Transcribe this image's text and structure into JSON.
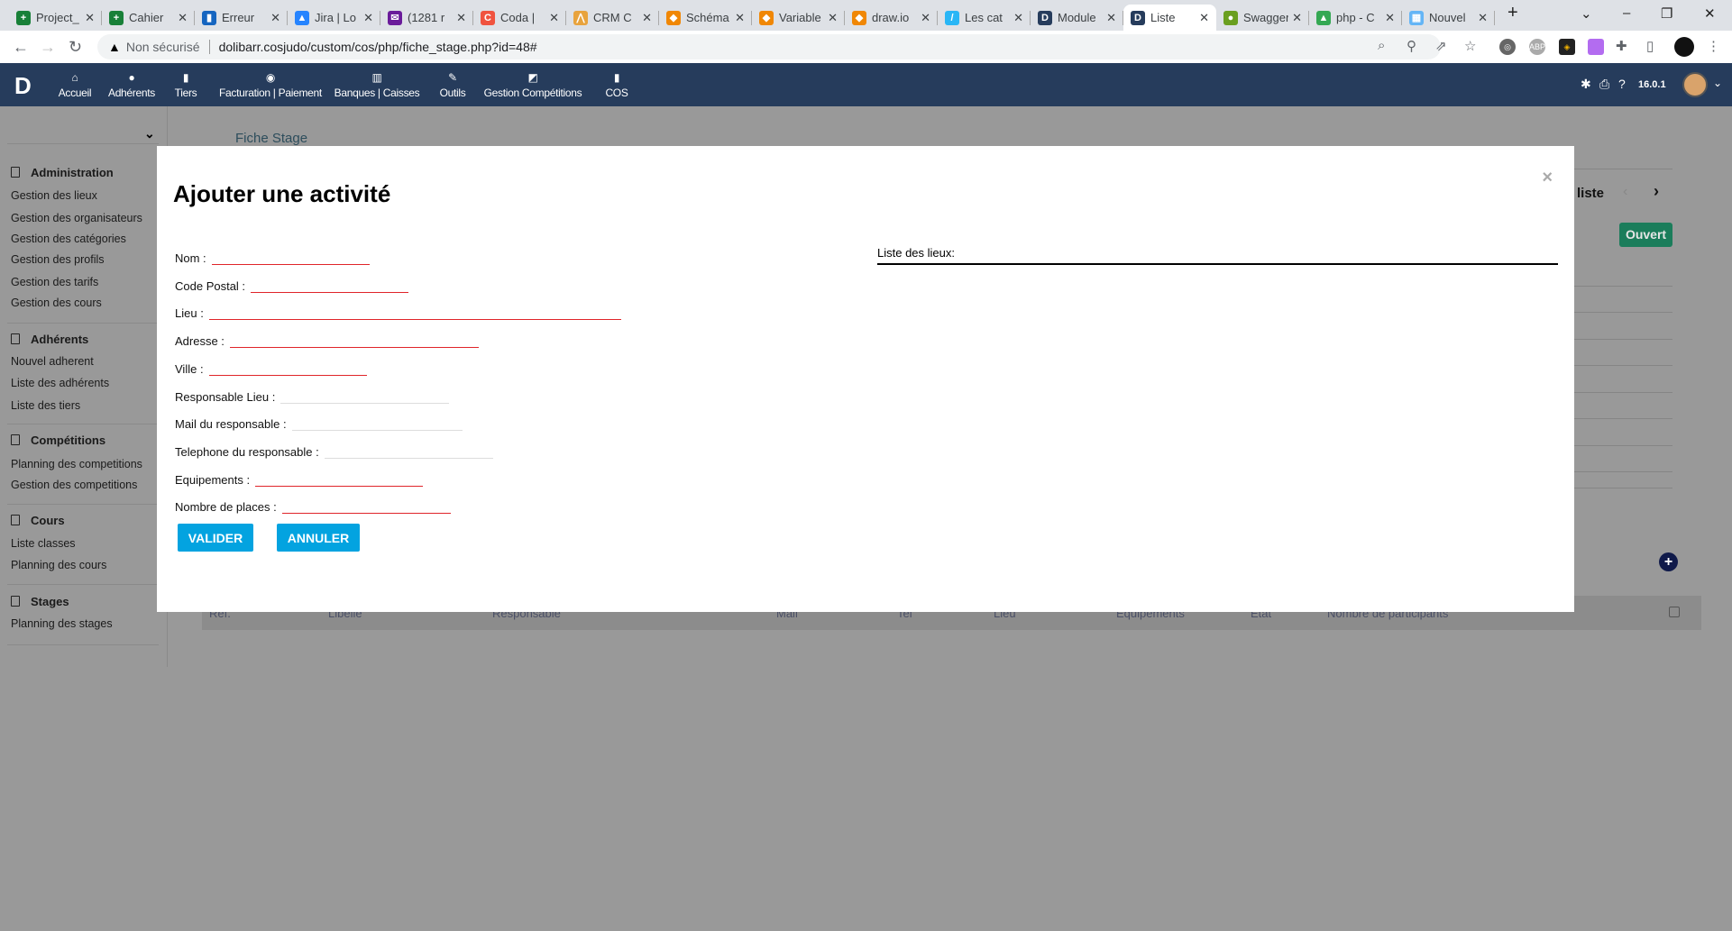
{
  "browser": {
    "tabs": [
      {
        "title": "Project_",
        "color": "#188038",
        "glyph": "+"
      },
      {
        "title": "Cahier",
        "color": "#188038",
        "glyph": "+"
      },
      {
        "title": "Erreur",
        "color": "#1565c0",
        "glyph": "▮"
      },
      {
        "title": "Jira | Lo",
        "color": "#2684ff",
        "glyph": "▲"
      },
      {
        "title": "(1281 r",
        "color": "#6a1b9a",
        "glyph": "✉"
      },
      {
        "title": "Coda |",
        "color": "#f0533f",
        "glyph": "C"
      },
      {
        "title": "CRM C",
        "color": "#e8a33d",
        "glyph": "⋀"
      },
      {
        "title": "Schéma",
        "color": "#f08705",
        "glyph": "◆"
      },
      {
        "title": "Variable",
        "color": "#f08705",
        "glyph": "◆"
      },
      {
        "title": "draw.io",
        "color": "#f08705",
        "glyph": "◆"
      },
      {
        "title": "Les cat",
        "color": "#29b6f6",
        "glyph": "/"
      },
      {
        "title": "Module",
        "color": "#263c5c",
        "glyph": "D"
      },
      {
        "title": "Liste",
        "color": "#263c5c",
        "glyph": "D",
        "active": true
      },
      {
        "title": "Swagger",
        "color": "#6a9f1f",
        "glyph": "●"
      },
      {
        "title": "php - C",
        "color": "#34a853",
        "glyph": "▲"
      },
      {
        "title": "Nouvel",
        "color": "#64b5f6",
        "glyph": "▦"
      }
    ],
    "security_label": "Non sécurisé",
    "url": "dolibarr.cosjudo/custom/cos/php/fiche_stage.php?id=48#"
  },
  "nav": {
    "logo": "D",
    "menus": [
      {
        "label": "Accueil",
        "icon": "home-icon",
        "glyph": "⌂"
      },
      {
        "label": "Adhérents",
        "icon": "user-icon",
        "glyph": "●"
      },
      {
        "label": "Tiers",
        "icon": "building-icon",
        "glyph": "▮"
      },
      {
        "label": "Facturation | Paiement",
        "icon": "coins-icon",
        "glyph": "◉"
      },
      {
        "label": "Banques | Caisses",
        "icon": "bank-icon",
        "glyph": "▥"
      },
      {
        "label": "Outils",
        "icon": "wrench-icon",
        "glyph": "✎"
      },
      {
        "label": "Gestion Compétitions",
        "icon": "edit-icon",
        "glyph": "◩"
      },
      {
        "label": "COS",
        "icon": "file-icon",
        "glyph": "▮"
      }
    ],
    "version": "16.0.1"
  },
  "sidebar": {
    "sections": [
      {
        "title": "Administration",
        "items": [
          "Gestion des lieux",
          "Gestion des organisateurs",
          "Gestion des catégories",
          "Gestion des profils",
          "Gestion des tarifs",
          "Gestion des cours"
        ]
      },
      {
        "title": "Adhérents",
        "items": [
          "Nouvel adherent",
          "Liste des adhérents",
          "Liste des tiers"
        ]
      },
      {
        "title": "Compétitions",
        "items": [
          "Planning des competitions",
          "Gestion des competitions"
        ]
      },
      {
        "title": "Cours",
        "items": [
          "Liste classes",
          "Planning des cours"
        ]
      },
      {
        "title": "Stages",
        "items": [
          "Planning des stages"
        ]
      }
    ]
  },
  "page": {
    "title": "Fiche Stage",
    "back_to_list": "liste",
    "status": "Ouvert",
    "status_color": "#1b7d5b",
    "table_headers": [
      "Ref.",
      "Libelle",
      "Responsable",
      "Mail",
      "Tel",
      "Lieu",
      "Equipements",
      "Etat",
      "Nombre de participants"
    ]
  },
  "modal": {
    "title": "Ajouter une activité",
    "close": "×",
    "fields": [
      {
        "label": "Nom :",
        "value": "",
        "required": true
      },
      {
        "label": "Code Postal :",
        "value": "",
        "required": true
      },
      {
        "label": "Lieu :",
        "value": "",
        "required": true
      },
      {
        "label": "Adresse :",
        "value": "",
        "required": true
      },
      {
        "label": "Ville :",
        "value": "",
        "required": true
      },
      {
        "label": "Responsable Lieu :",
        "value": "",
        "required": false
      },
      {
        "label": "Mail du responsable :",
        "value": "",
        "required": false
      },
      {
        "label": "Telephone du responsable :",
        "value": "",
        "required": false
      },
      {
        "label": "Equipements :",
        "value": "",
        "required": true
      },
      {
        "label": "Nombre de places :",
        "value": "",
        "required": true
      }
    ],
    "validate": "VALIDER",
    "cancel": "ANNULER",
    "list_label": "Liste des lieux:"
  }
}
